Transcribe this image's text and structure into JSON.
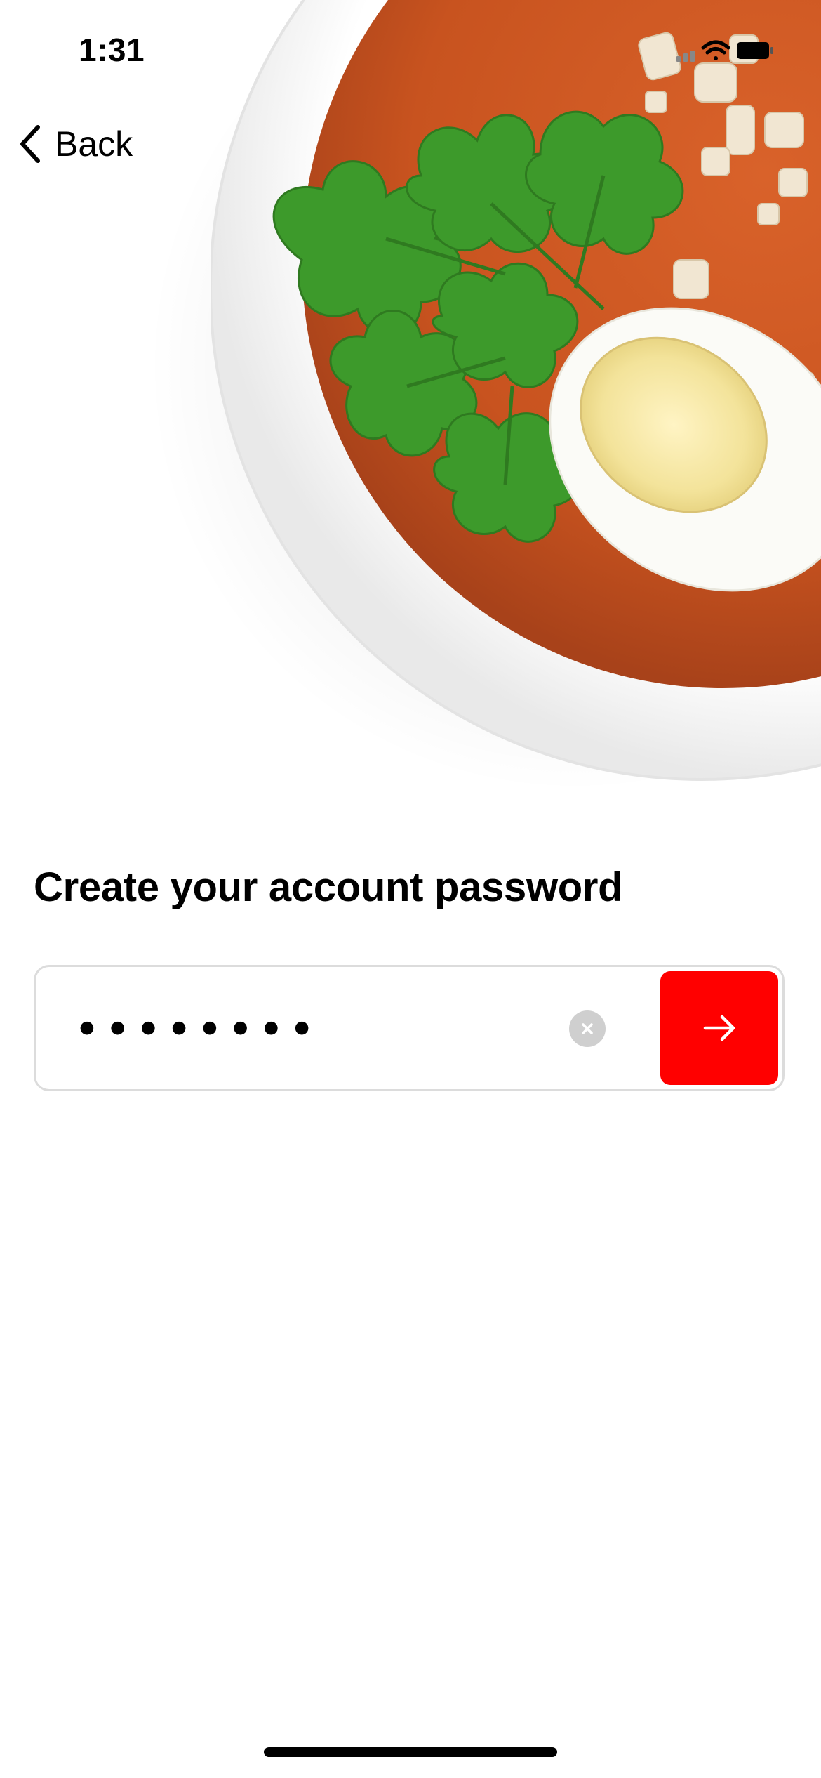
{
  "status_bar": {
    "time": "1:31",
    "icons": [
      "signal-icon",
      "wifi-icon",
      "battery-icon"
    ]
  },
  "nav": {
    "back_label": "Back"
  },
  "hero": {
    "image": "soup-bowl-with-egg-and-parsley"
  },
  "form": {
    "heading": "Create your account password",
    "password_value": "••••••••",
    "clear_icon": "clear-icon",
    "submit_icon": "arrow-right-icon"
  },
  "colors": {
    "accent": "#ff0000",
    "text": "#000000",
    "field_border": "#dcdcdc",
    "clear_bg": "#cfcfcf"
  }
}
